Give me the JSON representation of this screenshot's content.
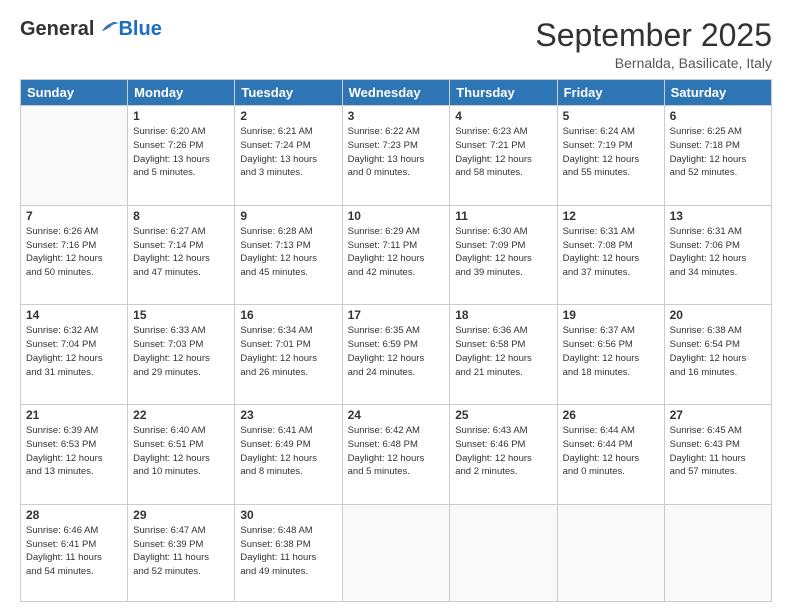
{
  "logo": {
    "general": "General",
    "blue": "Blue"
  },
  "header": {
    "month": "September 2025",
    "location": "Bernalda, Basilicate, Italy"
  },
  "days_of_week": [
    "Sunday",
    "Monday",
    "Tuesday",
    "Wednesday",
    "Thursday",
    "Friday",
    "Saturday"
  ],
  "weeks": [
    [
      {
        "day": "",
        "info": ""
      },
      {
        "day": "1",
        "info": "Sunrise: 6:20 AM\nSunset: 7:26 PM\nDaylight: 13 hours\nand 5 minutes."
      },
      {
        "day": "2",
        "info": "Sunrise: 6:21 AM\nSunset: 7:24 PM\nDaylight: 13 hours\nand 3 minutes."
      },
      {
        "day": "3",
        "info": "Sunrise: 6:22 AM\nSunset: 7:23 PM\nDaylight: 13 hours\nand 0 minutes."
      },
      {
        "day": "4",
        "info": "Sunrise: 6:23 AM\nSunset: 7:21 PM\nDaylight: 12 hours\nand 58 minutes."
      },
      {
        "day": "5",
        "info": "Sunrise: 6:24 AM\nSunset: 7:19 PM\nDaylight: 12 hours\nand 55 minutes."
      },
      {
        "day": "6",
        "info": "Sunrise: 6:25 AM\nSunset: 7:18 PM\nDaylight: 12 hours\nand 52 minutes."
      }
    ],
    [
      {
        "day": "7",
        "info": "Sunrise: 6:26 AM\nSunset: 7:16 PM\nDaylight: 12 hours\nand 50 minutes."
      },
      {
        "day": "8",
        "info": "Sunrise: 6:27 AM\nSunset: 7:14 PM\nDaylight: 12 hours\nand 47 minutes."
      },
      {
        "day": "9",
        "info": "Sunrise: 6:28 AM\nSunset: 7:13 PM\nDaylight: 12 hours\nand 45 minutes."
      },
      {
        "day": "10",
        "info": "Sunrise: 6:29 AM\nSunset: 7:11 PM\nDaylight: 12 hours\nand 42 minutes."
      },
      {
        "day": "11",
        "info": "Sunrise: 6:30 AM\nSunset: 7:09 PM\nDaylight: 12 hours\nand 39 minutes."
      },
      {
        "day": "12",
        "info": "Sunrise: 6:31 AM\nSunset: 7:08 PM\nDaylight: 12 hours\nand 37 minutes."
      },
      {
        "day": "13",
        "info": "Sunrise: 6:31 AM\nSunset: 7:06 PM\nDaylight: 12 hours\nand 34 minutes."
      }
    ],
    [
      {
        "day": "14",
        "info": "Sunrise: 6:32 AM\nSunset: 7:04 PM\nDaylight: 12 hours\nand 31 minutes."
      },
      {
        "day": "15",
        "info": "Sunrise: 6:33 AM\nSunset: 7:03 PM\nDaylight: 12 hours\nand 29 minutes."
      },
      {
        "day": "16",
        "info": "Sunrise: 6:34 AM\nSunset: 7:01 PM\nDaylight: 12 hours\nand 26 minutes."
      },
      {
        "day": "17",
        "info": "Sunrise: 6:35 AM\nSunset: 6:59 PM\nDaylight: 12 hours\nand 24 minutes."
      },
      {
        "day": "18",
        "info": "Sunrise: 6:36 AM\nSunset: 6:58 PM\nDaylight: 12 hours\nand 21 minutes."
      },
      {
        "day": "19",
        "info": "Sunrise: 6:37 AM\nSunset: 6:56 PM\nDaylight: 12 hours\nand 18 minutes."
      },
      {
        "day": "20",
        "info": "Sunrise: 6:38 AM\nSunset: 6:54 PM\nDaylight: 12 hours\nand 16 minutes."
      }
    ],
    [
      {
        "day": "21",
        "info": "Sunrise: 6:39 AM\nSunset: 6:53 PM\nDaylight: 12 hours\nand 13 minutes."
      },
      {
        "day": "22",
        "info": "Sunrise: 6:40 AM\nSunset: 6:51 PM\nDaylight: 12 hours\nand 10 minutes."
      },
      {
        "day": "23",
        "info": "Sunrise: 6:41 AM\nSunset: 6:49 PM\nDaylight: 12 hours\nand 8 minutes."
      },
      {
        "day": "24",
        "info": "Sunrise: 6:42 AM\nSunset: 6:48 PM\nDaylight: 12 hours\nand 5 minutes."
      },
      {
        "day": "25",
        "info": "Sunrise: 6:43 AM\nSunset: 6:46 PM\nDaylight: 12 hours\nand 2 minutes."
      },
      {
        "day": "26",
        "info": "Sunrise: 6:44 AM\nSunset: 6:44 PM\nDaylight: 12 hours\nand 0 minutes."
      },
      {
        "day": "27",
        "info": "Sunrise: 6:45 AM\nSunset: 6:43 PM\nDaylight: 11 hours\nand 57 minutes."
      }
    ],
    [
      {
        "day": "28",
        "info": "Sunrise: 6:46 AM\nSunset: 6:41 PM\nDaylight: 11 hours\nand 54 minutes."
      },
      {
        "day": "29",
        "info": "Sunrise: 6:47 AM\nSunset: 6:39 PM\nDaylight: 11 hours\nand 52 minutes."
      },
      {
        "day": "30",
        "info": "Sunrise: 6:48 AM\nSunset: 6:38 PM\nDaylight: 11 hours\nand 49 minutes."
      },
      {
        "day": "",
        "info": ""
      },
      {
        "day": "",
        "info": ""
      },
      {
        "day": "",
        "info": ""
      },
      {
        "day": "",
        "info": ""
      }
    ]
  ]
}
